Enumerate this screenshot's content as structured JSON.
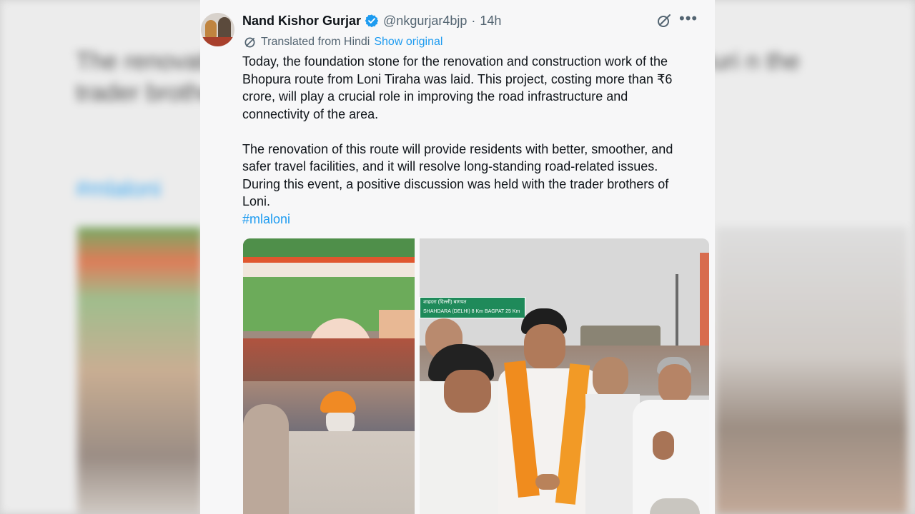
{
  "backdrop": {
    "paragraph_1": "The renovati   smoother, and safer tra   road-related issues. Duri   n the trader brothers of L",
    "hashtag": "#mlaloni"
  },
  "tweet": {
    "author_name": "Nand Kishor Gurjar",
    "handle": "@nkgurjar4bjp",
    "separator": "·",
    "time": "14h",
    "verified_color": "#1d9bf0",
    "translated_label": "Translated from Hindi",
    "show_original_label": "Show original",
    "paragraph_1": "Today, the foundation stone for the renovation and construction work of the Bhopura route from Loni Tiraha was laid. This project, costing more than ₹6 crore, will play a crucial role in improving the road infrastructure and connectivity of the area.",
    "paragraph_2": "The renovation of this route will provide residents with better, smoother, and safer travel facilities, and it will resolve long-standing road-related issues. During this event, a positive discussion was held with the trader brothers of Loni.",
    "hashtag": "#mlaloni",
    "more_icon": "more-icon",
    "grok_icon": "grok-icon",
    "sign": {
      "line_1": "शाहदरा (दिल्ली)        बागपत",
      "line_2": "SHAHDARA (DELHI) 8 Km  BAGPAT 25 Km"
    }
  }
}
